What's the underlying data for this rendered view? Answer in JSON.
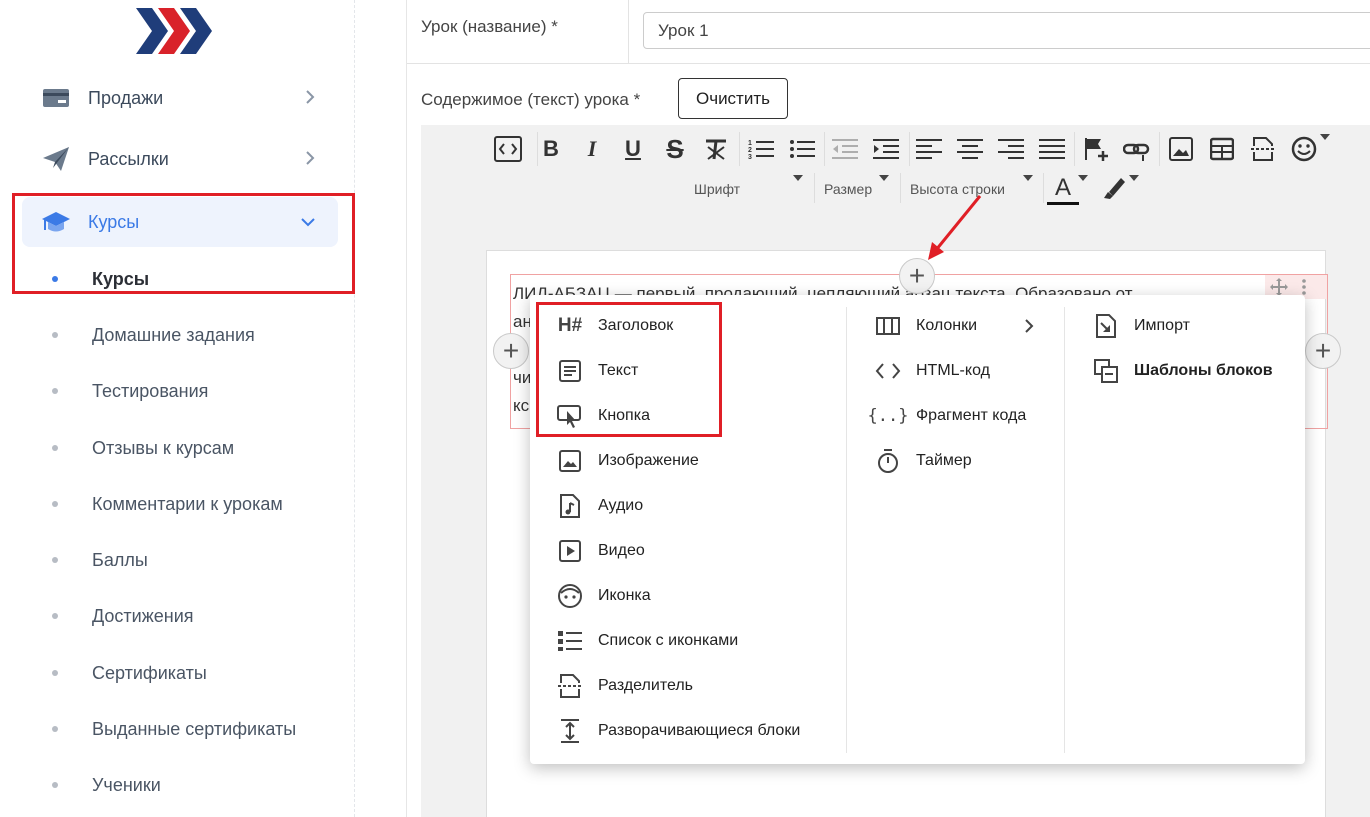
{
  "sidebar": {
    "nav": [
      {
        "label": "Продажи",
        "icon": "card-icon"
      },
      {
        "label": "Рассылки",
        "icon": "paper-plane-icon"
      },
      {
        "label": "Курсы",
        "icon": "graduation-cap-icon"
      }
    ],
    "sub_items": [
      {
        "label": "Курсы",
        "active": true
      },
      {
        "label": "Домашние задания"
      },
      {
        "label": "Тестирования"
      },
      {
        "label": "Отзывы к курсам"
      },
      {
        "label": "Комментарии к урокам"
      },
      {
        "label": "Баллы"
      },
      {
        "label": "Достижения"
      },
      {
        "label": "Сертификаты"
      },
      {
        "label": "Выданные сертификаты"
      },
      {
        "label": "Ученики"
      }
    ]
  },
  "form": {
    "lesson_label": "Урок (название) *",
    "lesson_value": "Урок 1",
    "content_label": "Содержимое (текст) урока *",
    "clear_button": "Очистить"
  },
  "toolbar": {
    "font_label": "Шрифт",
    "size_label": "Размер",
    "line_height_label": "Высота строки",
    "font_color_glyph": "A"
  },
  "editor": {
    "block_lines": [
      "ЛИД-АБЗАЦ — первый, продающий, цепляющий абзац текста. Образовано от",
      "ан",
      "",
      "чи",
      "кс"
    ]
  },
  "popup": {
    "col1": [
      {
        "label": "Заголовок",
        "icon": "heading-icon"
      },
      {
        "label": "Текст",
        "icon": "text-icon"
      },
      {
        "label": "Кнопка",
        "icon": "button-click-icon"
      },
      {
        "label": "Изображение",
        "icon": "image-icon"
      },
      {
        "label": "Аудио",
        "icon": "audio-file-icon"
      },
      {
        "label": "Видео",
        "icon": "video-icon"
      },
      {
        "label": "Иконка",
        "icon": "face-icon"
      },
      {
        "label": "Список с иконками",
        "icon": "icon-list-icon"
      },
      {
        "label": "Разделитель",
        "icon": "divider-icon"
      },
      {
        "label": "Разворачивающиеся блоки",
        "icon": "expand-icon"
      }
    ],
    "col2": [
      {
        "label": "Колонки",
        "icon": "columns-icon"
      },
      {
        "label": "HTML-код",
        "icon": "code-icon"
      },
      {
        "label": "Фрагмент кода",
        "icon": "code-fragment-icon"
      },
      {
        "label": "Таймер",
        "icon": "timer-icon"
      }
    ],
    "col3": [
      {
        "label": "Импорт",
        "icon": "import-icon"
      },
      {
        "label": "Шаблоны блоков",
        "icon": "templates-icon",
        "bold": true
      }
    ]
  },
  "colors": {
    "accent": "#3b7ae6",
    "highlight_box": "#e01f26",
    "logo_navy": "#1f3d7a",
    "logo_red": "#d9222a"
  }
}
